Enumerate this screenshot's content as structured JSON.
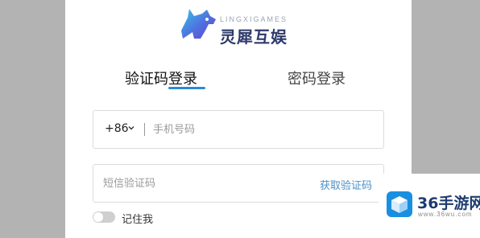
{
  "logo": {
    "english": "LINGXIGAMES",
    "chinese": "灵犀互娱"
  },
  "tabs": [
    {
      "label": "验证码登录",
      "active": true
    },
    {
      "label": "密码登录",
      "active": false
    }
  ],
  "phone": {
    "country_code": "+86",
    "placeholder": "手机号码",
    "value": ""
  },
  "code": {
    "placeholder": "短信验证码",
    "value": "",
    "get_code_label": "获取验证码"
  },
  "remember": {
    "label": "记住我",
    "enabled": false
  },
  "watermark": {
    "title": "36手游网",
    "subtitle": "www.36wu.com"
  },
  "colors": {
    "accent": "#2b8ad6",
    "link": "#4a90c8",
    "brand": "#2e3a6b"
  }
}
